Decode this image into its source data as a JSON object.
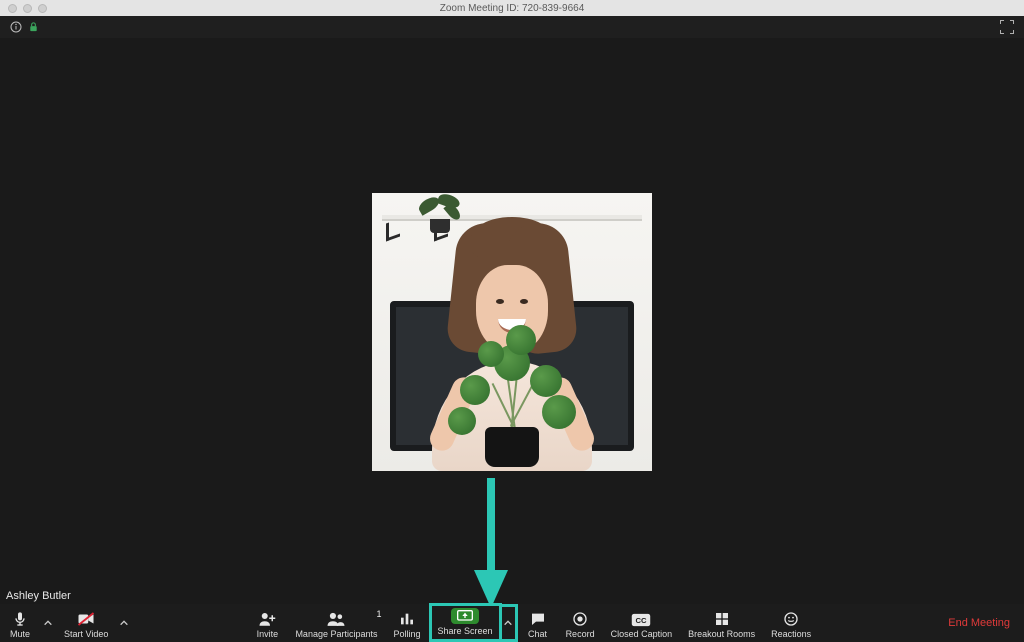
{
  "titlebar": {
    "title": "Zoom Meeting ID: 720-839-9664"
  },
  "participant": {
    "name": "Ashley Butler"
  },
  "toolbar": {
    "mute": "Mute",
    "start_video": "Start Video",
    "invite": "Invite",
    "manage_participants": "Manage Participants",
    "participants_count": "1",
    "polling": "Polling",
    "share_screen": "Share Screen",
    "chat": "Chat",
    "record": "Record",
    "closed_caption": "Closed Caption",
    "breakout_rooms": "Breakout Rooms",
    "reactions": "Reactions",
    "end_meeting": "End Meeting"
  },
  "colors": {
    "highlight": "#2cc7b5",
    "share_green": "#2e8b2e",
    "end_red": "#e03a3a"
  }
}
